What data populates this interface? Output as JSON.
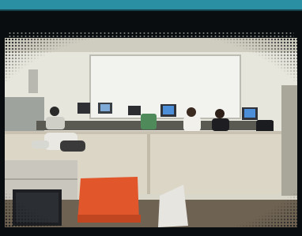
{
  "photo": {
    "subject": "office-room",
    "colors": {
      "wall": "#e7e6dc",
      "whiteboard": "#f2f3ef",
      "partition": "#dcd6c7",
      "floor": "#6e6252",
      "chair_orange": "#e2562b",
      "monitor_screen": "#4d8ed8"
    }
  },
  "theme": {
    "top_bar": "#2a8fa3",
    "background": "#0a0d10"
  }
}
